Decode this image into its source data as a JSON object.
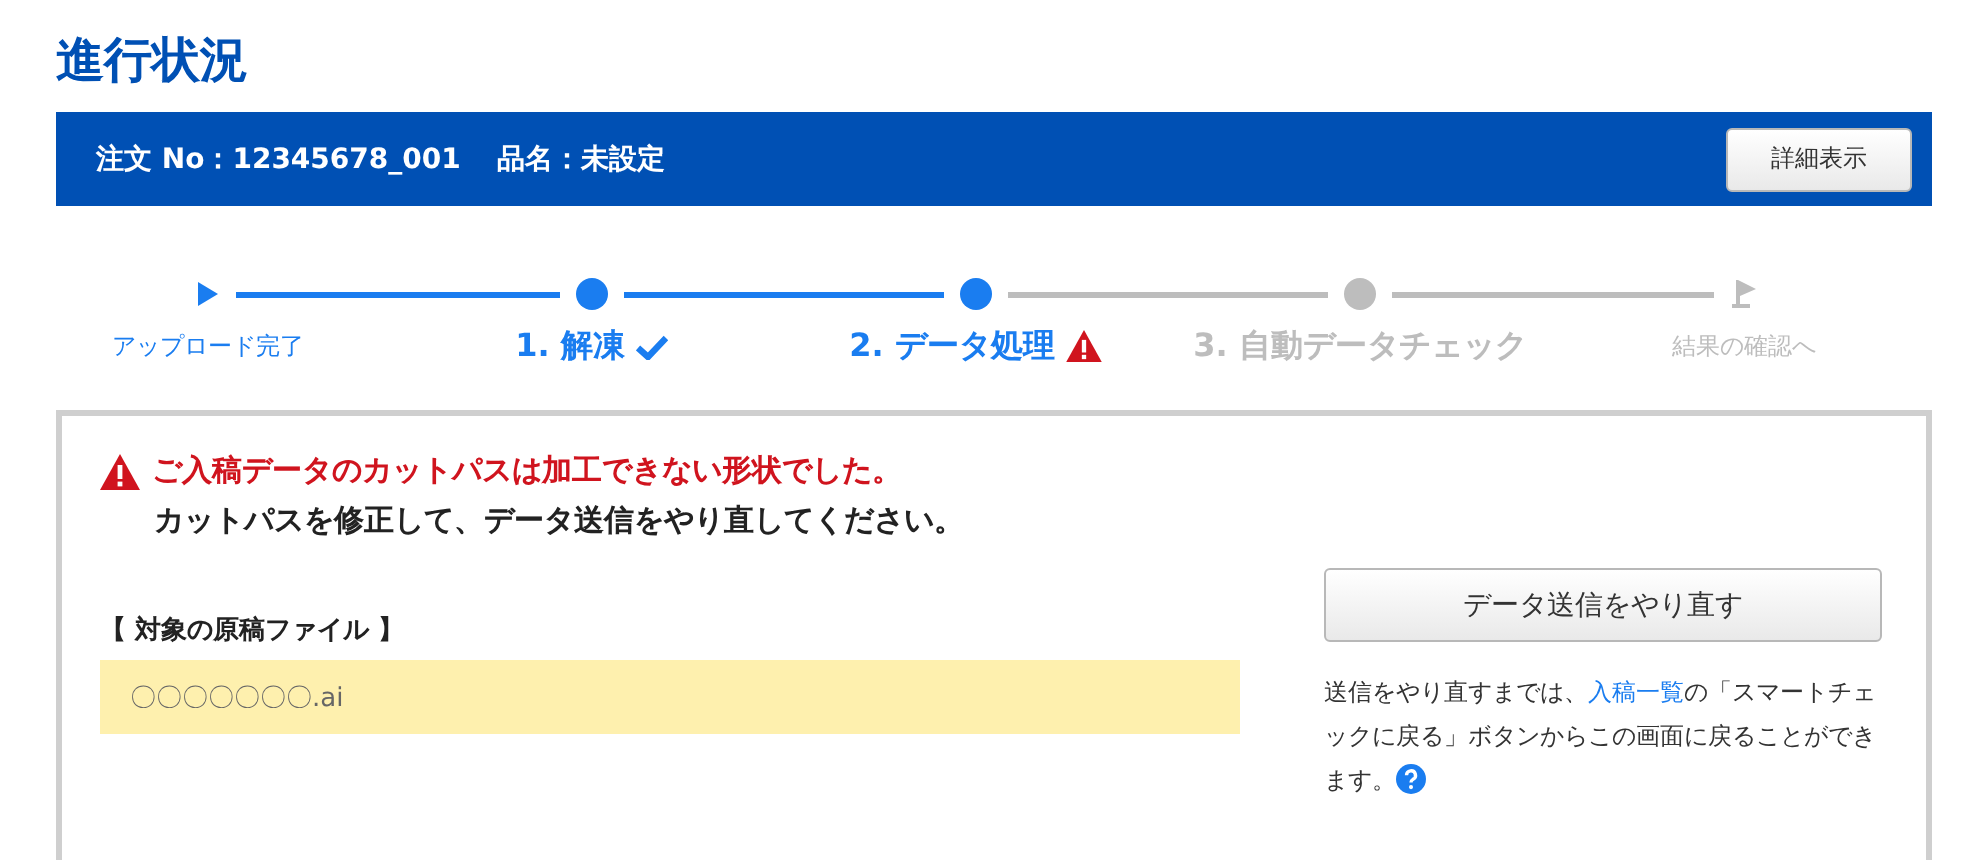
{
  "title": "進行状況",
  "order_bar": {
    "order_no": "注文 No：12345678_001",
    "product": "品名：未設定",
    "detail_button": "詳細表示"
  },
  "steps": [
    {
      "kind": "start",
      "label": "アップロード完了",
      "reached": true,
      "warning": false
    },
    {
      "kind": "step",
      "label": "1. 解凍",
      "reached": true,
      "warning": false
    },
    {
      "kind": "step",
      "label": "2. データ処理",
      "reached": true,
      "warning": true
    },
    {
      "kind": "step",
      "label": "3. 自動データチェック",
      "reached": false,
      "warning": false
    },
    {
      "kind": "end",
      "label": "結果の確認へ",
      "reached": false,
      "warning": false
    }
  ],
  "alert": {
    "error": "ご入稿データのカットパスは加工できない形状でした。",
    "instruction": "カットパスを修正して、データ送信をやり直してください。"
  },
  "file": {
    "heading": "【 対象の原稿ファイル 】",
    "name": "〇〇〇〇〇〇〇.ai"
  },
  "resend_button": "データ送信をやり直す",
  "note": {
    "before": "送信をやり直すまでは、",
    "link": "入稿一覧",
    "after": "の「スマートチェックに戻る」ボタンからこの画面に戻ることができます。"
  }
}
